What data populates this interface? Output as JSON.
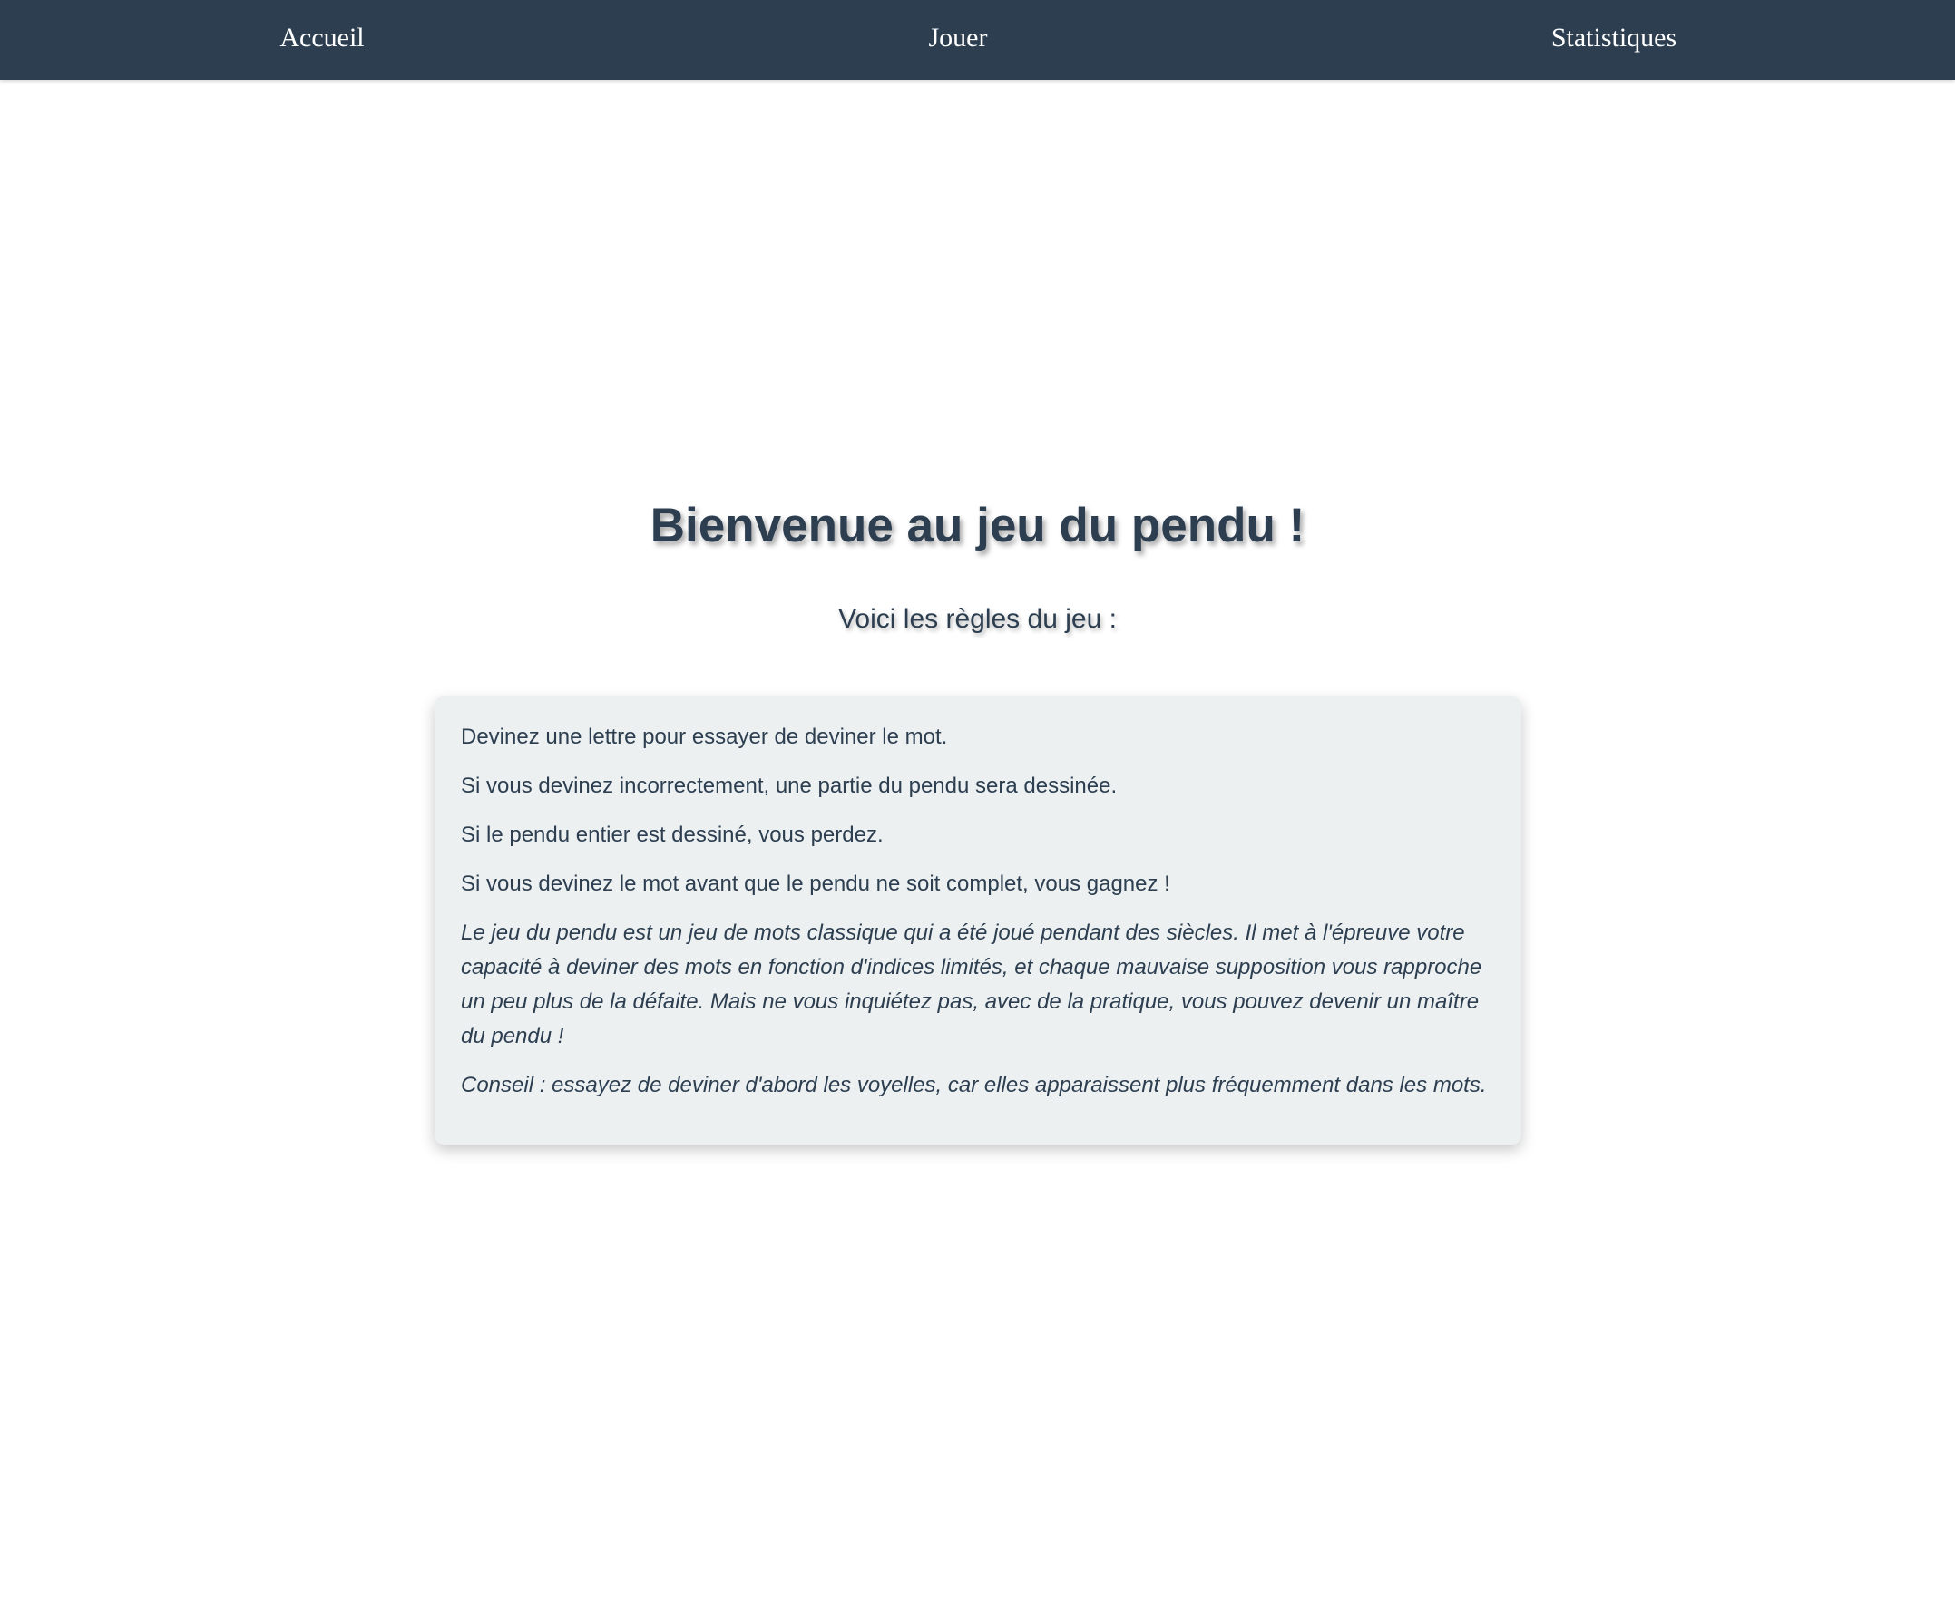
{
  "nav": {
    "items": [
      {
        "label": "Accueil"
      },
      {
        "label": "Jouer"
      },
      {
        "label": "Statistiques"
      }
    ]
  },
  "main": {
    "title": "Bienvenue au jeu du pendu !",
    "subtitle": "Voici les règles du jeu :",
    "rules": [
      "Devinez une lettre pour essayer de deviner le mot.",
      "Si vous devinez incorrectement, une partie du pendu sera dessinée.",
      "Si le pendu entier est dessiné, vous perdez.",
      "Si vous devinez le mot avant que le pendu ne soit complet, vous gagnez !"
    ],
    "description": "Le jeu du pendu est un jeu de mots classique qui a été joué pendant des siècles. Il met à l'épreuve votre capacité à deviner des mots en fonction d'indices limités, et chaque mauvaise supposition vous rapproche un peu plus de la défaite. Mais ne vous inquiétez pas, avec de la pratique, vous pouvez devenir un maître du pendu !",
    "tip": "Conseil : essayez de deviner d'abord les voyelles, car elles apparaissent plus fréquemment dans les mots."
  },
  "colors": {
    "navbar_bg": "#2c3e50",
    "text": "#2c3e50",
    "box_bg": "#ecf0f1"
  }
}
